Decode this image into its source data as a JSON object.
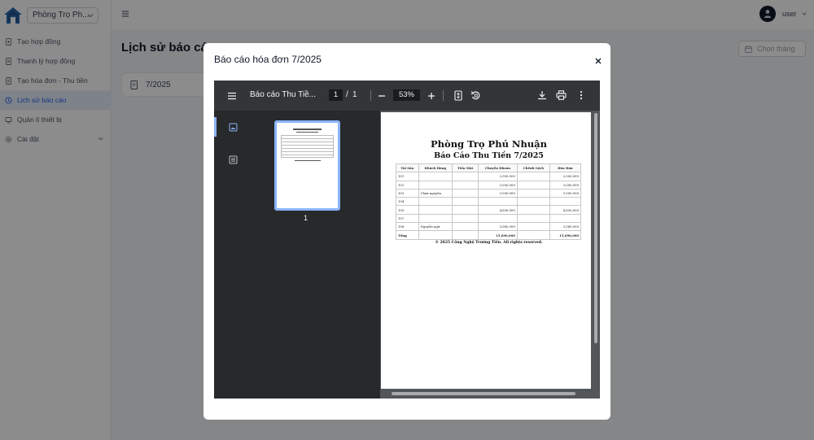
{
  "sidebar": {
    "site_name": "Phòng Trọ Ph...",
    "items": [
      {
        "label": "Tạo hợp đồng",
        "icon": "file-plus-icon",
        "active": false
      },
      {
        "label": "Thanh lý hợp đồng",
        "icon": "file-x-icon",
        "active": false
      },
      {
        "label": "Tạo hóa đơn - Thu tiền",
        "icon": "file-text-icon",
        "active": false
      },
      {
        "label": "Lịch sử báo cáo",
        "icon": "history-icon",
        "active": true
      },
      {
        "label": "Quản lí thiết bị",
        "icon": "device-icon",
        "active": false
      },
      {
        "label": "Cài đặt",
        "icon": "settings-icon",
        "active": false
      }
    ]
  },
  "topbar": {
    "user_label": "user"
  },
  "main": {
    "title": "Lịch sử báo cáo",
    "pick_month_placeholder": "Chọn tháng",
    "report_card_label": "7/2025"
  },
  "modal": {
    "title": "Báo cáo hóa đơn 7/2025",
    "pdf": {
      "doc_title": "Báo cáo Thu Tiề...",
      "current_page": "1",
      "page_separator": "/",
      "total_pages": "1",
      "zoom": "53%",
      "thumbnail_label": "1",
      "report": {
        "title": "Phòng Trọ Phú Nhuận",
        "subtitle": "Báo Cáo Thu Tiền 7/2025",
        "columns": [
          "Tài Sản",
          "Khách Hàng",
          "Tiền Mặt",
          "Chuyển Khoản",
          "Chênh Lệch",
          "Hóa Đơn"
        ],
        "rows": [
          [
            "101",
            "",
            "",
            "2,000,000",
            "",
            "2,000,000"
          ],
          [
            "102",
            "",
            "",
            "3,000,000",
            "",
            "3,000,000"
          ],
          [
            "103",
            "Chưa nguyên",
            "",
            "3,000,000",
            "",
            "3,000,000"
          ],
          [
            "104",
            "",
            "",
            "",
            "",
            ""
          ],
          [
            "105",
            "",
            "",
            "4,630,000",
            "",
            "4,630,000"
          ],
          [
            "107",
            "",
            "",
            "",
            "",
            ""
          ],
          [
            "108",
            "Nguyễn ngữ",
            "",
            "3,060,000",
            "",
            "3,060,000"
          ]
        ],
        "total_row": [
          "Tổng",
          "",
          "",
          "15,690,000",
          "",
          "15,690,000"
        ],
        "footer": "© 2025 Công Nghệ Trường Tiến. All rights reserved."
      }
    }
  },
  "colors": {
    "accent": "#2563eb",
    "active_bg": "#e6eefc",
    "pdf_toolbar": "#323639",
    "pdf_sidebar": "#28292b",
    "pdf_bg": "#525659",
    "thumb_border": "#8ab4f8"
  }
}
